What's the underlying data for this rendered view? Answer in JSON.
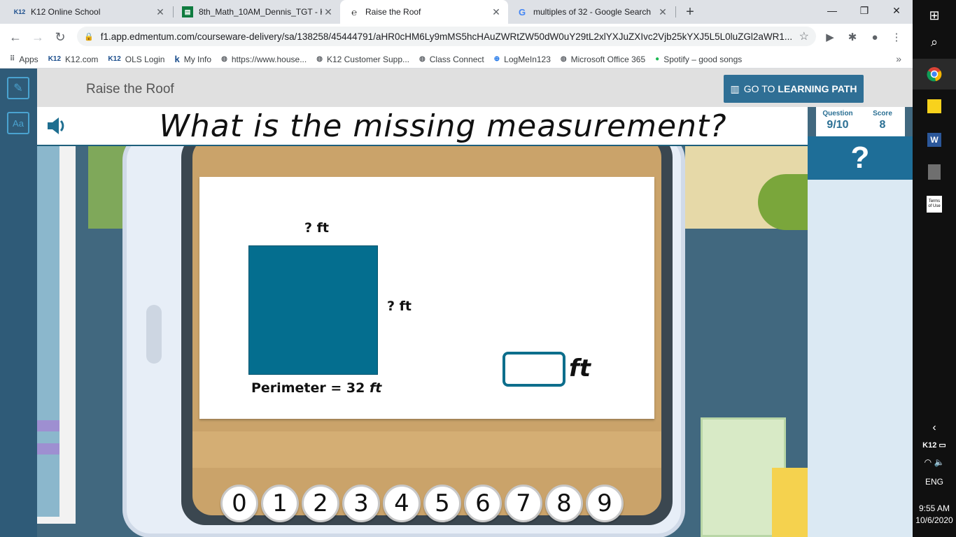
{
  "browser": {
    "tabs": [
      {
        "favicon": "K12",
        "title": "K12 Online School",
        "active": false
      },
      {
        "favicon": "sheet",
        "title": "8th_Math_10AM_Dennis_TGT - K",
        "active": false
      },
      {
        "favicon": "e",
        "title": "Raise the Roof",
        "active": true
      },
      {
        "favicon": "G",
        "title": "multiples of 32 - Google Search",
        "active": false
      }
    ],
    "url": "f1.app.edmentum.com/courseware-delivery/sa/138258/45444791/aHR0cHM6Ly9mMS5hcHAuZWRtZW50dW0uY29tL2xlYXJuZXIvc2Vjb25kYXJ5L25kYXJ5L5L0luZGl2aWR1YWxpemVkX2ZpbGUvYWR1YWxpemVkL0luZGl2aWR1YWxpemVkL0luZGl2aWR1...",
    "url_display": "f1.app.edmentum.com/courseware-delivery/sa/138258/45444791/aHR0cHM6Ly9mMS5hcHAuZWRtZW50dW0uY29tL2xlYXJuZXIvc2Vjb25kYXJ5L5L0luZGl2aWR1...",
    "bookmarks": [
      {
        "icon": "apps-grid-icon",
        "label": "Apps"
      },
      {
        "icon": "K12",
        "label": "K12.com"
      },
      {
        "icon": "K12",
        "label": "OLS Login"
      },
      {
        "icon": "k12-logo",
        "label": "My Info"
      },
      {
        "icon": "globe-icon",
        "label": "https://www.house..."
      },
      {
        "icon": "globe-icon",
        "label": "K12 Customer Supp..."
      },
      {
        "icon": "globe-icon",
        "label": "Class Connect"
      },
      {
        "icon": "plus-circle-icon",
        "label": "LogMeIn123"
      },
      {
        "icon": "globe-icon",
        "label": "Microsoft Office 365"
      },
      {
        "icon": "spotify-icon",
        "label": "Spotify – good songs"
      }
    ]
  },
  "app": {
    "lesson_title": "Raise the Roof",
    "learning_path_prefix": "GO TO",
    "learning_path_bold": "LEARNING PATH",
    "question": "What is the missing measurement?",
    "score": {
      "question_label": "Question",
      "question_value": "9/10",
      "score_label": "Score",
      "score_value": "8"
    },
    "help_label": "?",
    "problem": {
      "top_label": "? ft",
      "side_label": "? ft",
      "perimeter_label": "Perimeter = 32",
      "perimeter_unit": "ft",
      "answer_value": "",
      "answer_unit": "ft",
      "shape_color": "#046e8f"
    },
    "keypad": [
      "0",
      "1",
      "2",
      "3",
      "4",
      "5",
      "6",
      "7",
      "8",
      "9"
    ]
  },
  "taskbar": {
    "items": [
      "windows-start-icon",
      "search-icon",
      "chrome-icon",
      "sticky-notes-icon",
      "word-icon",
      "calculator-icon",
      "terms-of-use-icon"
    ],
    "terms_label": "Terms of Use",
    "tray_label": "K12",
    "language": "ENG",
    "time": "9:55 AM",
    "date": "10/6/2020"
  }
}
